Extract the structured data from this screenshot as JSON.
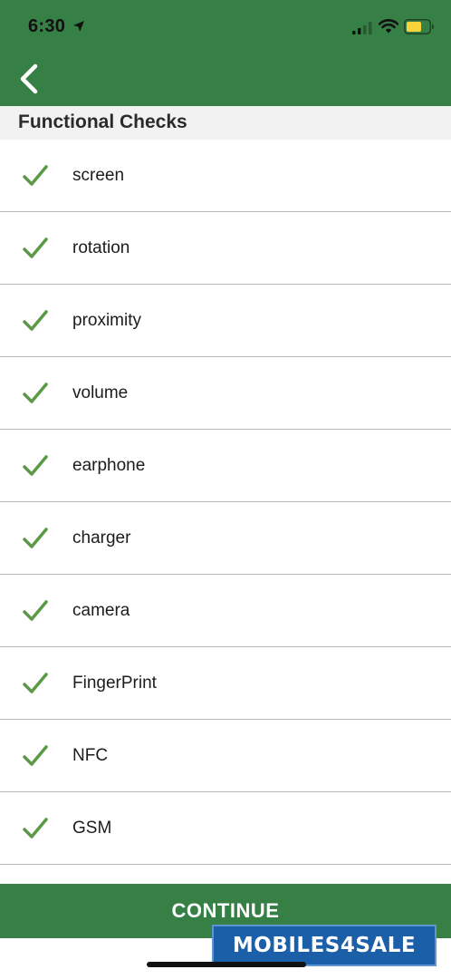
{
  "status_bar": {
    "time": "6:30",
    "icons": [
      "location-arrow-icon",
      "signal-icon",
      "wifi-icon",
      "battery-icon"
    ]
  },
  "header": {
    "back_icon": "chevron-left-icon"
  },
  "section": {
    "title": "Functional Checks"
  },
  "checks": [
    {
      "label": "screen",
      "status": "passed"
    },
    {
      "label": "rotation",
      "status": "passed"
    },
    {
      "label": "proximity",
      "status": "passed"
    },
    {
      "label": "volume",
      "status": "passed"
    },
    {
      "label": "earphone",
      "status": "passed"
    },
    {
      "label": "charger",
      "status": "passed"
    },
    {
      "label": "camera",
      "status": "passed"
    },
    {
      "label": "FingerPrint",
      "status": "passed"
    },
    {
      "label": "NFC",
      "status": "passed"
    },
    {
      "label": "GSM",
      "status": "passed"
    }
  ],
  "footer": {
    "continue_label": "CONTINUE"
  },
  "watermark": {
    "text": "MOBILES4SALE"
  },
  "colors": {
    "brand_green": "#367f45",
    "check_green": "#5a9a47",
    "section_bg": "#f2f2f2",
    "battery_yellow": "#f5d339"
  }
}
